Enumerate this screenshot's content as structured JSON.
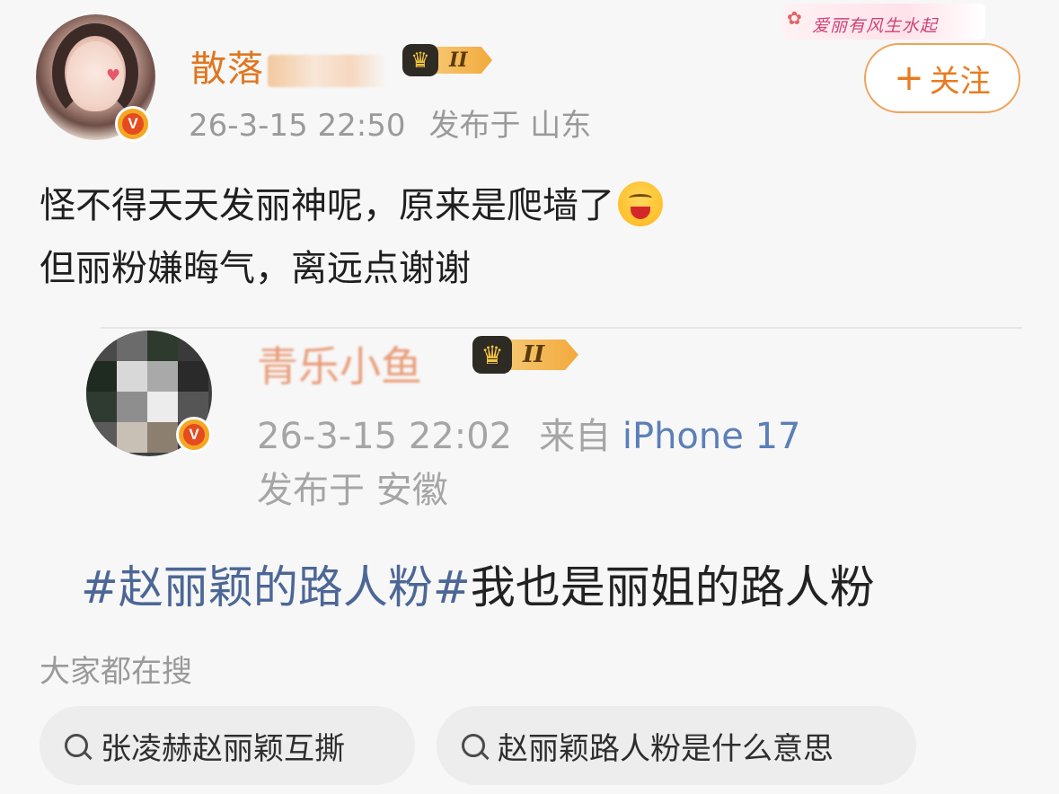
{
  "watermark": {
    "text": "爱丽有风生水起"
  },
  "post": {
    "username_visible": "散落",
    "level_badge": "II",
    "time": "26-3-15 22:50",
    "location": "发布于 山东",
    "follow_label": "关注",
    "follow_plus": "+",
    "lines": [
      "怪不得天天发丽神呢，原来是爬墙了",
      "但丽粉嫌晦气，离远点谢谢"
    ],
    "emoji_name": "drooling-face-emoji",
    "verified_badge": "V"
  },
  "quoted": {
    "username_visible": "青乐小鱼",
    "level_badge": "II",
    "time": "26-3-15 22:02",
    "source_prefix": "来自",
    "device": "iPhone 17",
    "location": "发布于 安徽",
    "topic": "#赵丽颖的路人粉#",
    "text": "我也是丽姐的路人粉",
    "verified_badge": "V"
  },
  "search": {
    "title": "大家都在搜",
    "suggestions": [
      "张凌赫赵丽颖互撕",
      "赵丽颖路人粉是什么意思"
    ]
  },
  "colors": {
    "accent_orange": "#ea7a1f",
    "topic_blue": "#4c6796",
    "device_blue": "#5b7fb8",
    "meta_gray": "#9a9a9a"
  }
}
